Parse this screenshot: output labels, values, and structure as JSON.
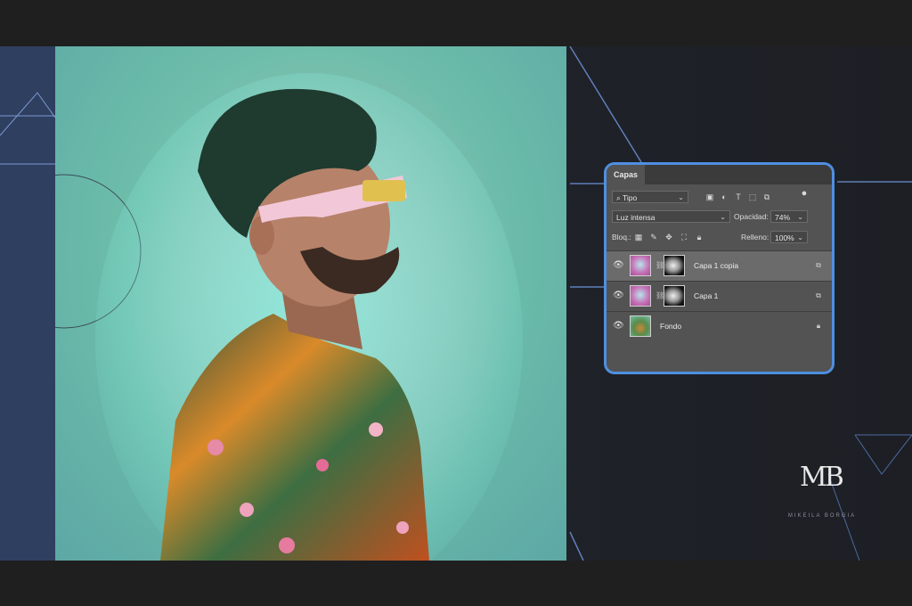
{
  "layers_panel": {
    "tab_title": "Capas",
    "filter": {
      "label": "Tipo"
    },
    "blend_mode": "Luz intensa",
    "opacity": {
      "label": "Opacidad:",
      "value": "74%"
    },
    "lock_label": "Bloq.:",
    "fill": {
      "label": "Relleno:",
      "value": "100%"
    },
    "layers": [
      {
        "name": "Capa 1 copia",
        "selected": true
      },
      {
        "name": "Capa 1",
        "selected": false
      },
      {
        "name": "Fondo",
        "selected": false
      }
    ]
  },
  "brand": {
    "logo_text": "MB",
    "logo_subtext": "MIKEILA BORGIA"
  },
  "colors": {
    "panel_border": "#4f8fe0",
    "panel_bg": "#535353",
    "selected_layer": "#6b6b6b"
  }
}
